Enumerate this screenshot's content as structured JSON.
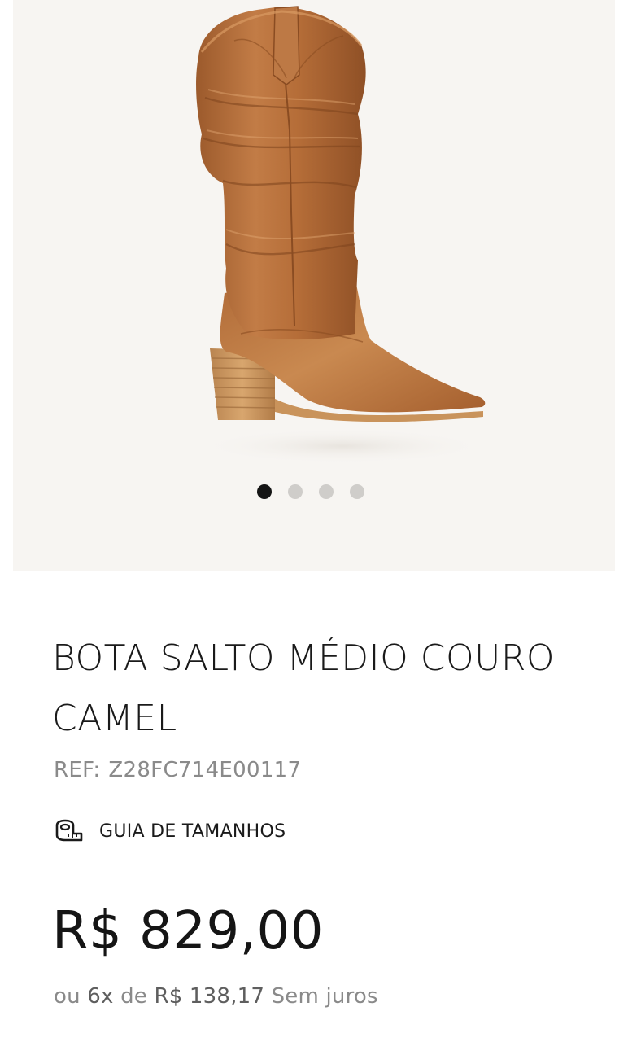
{
  "gallery": {
    "image_name": "tall camel leather cowboy boot with wooden block heel",
    "dot_count": 4,
    "active_index": 0
  },
  "product": {
    "title": "BOTA SALTO MÉDIO COURO CAMEL",
    "ref_label": "REF:",
    "ref_code": "Z28FC714E00117",
    "size_guide_label": "GUIA DE TAMANHOS",
    "size_guide_icon": "measuring-tape-icon",
    "price": "R$ 829,00",
    "installments": {
      "prefix": "ou",
      "count": "6x",
      "middle": "de",
      "amount": "R$ 138,17",
      "suffix": "Sem juros"
    }
  },
  "colors": {
    "gallery_bg": "#f7f5f2",
    "leather": "#b8723f",
    "heel_wood": "#c9935b",
    "dot_active": "#151515",
    "dot_inactive": "#cfcdca",
    "text_muted": "#8a8a8a"
  }
}
